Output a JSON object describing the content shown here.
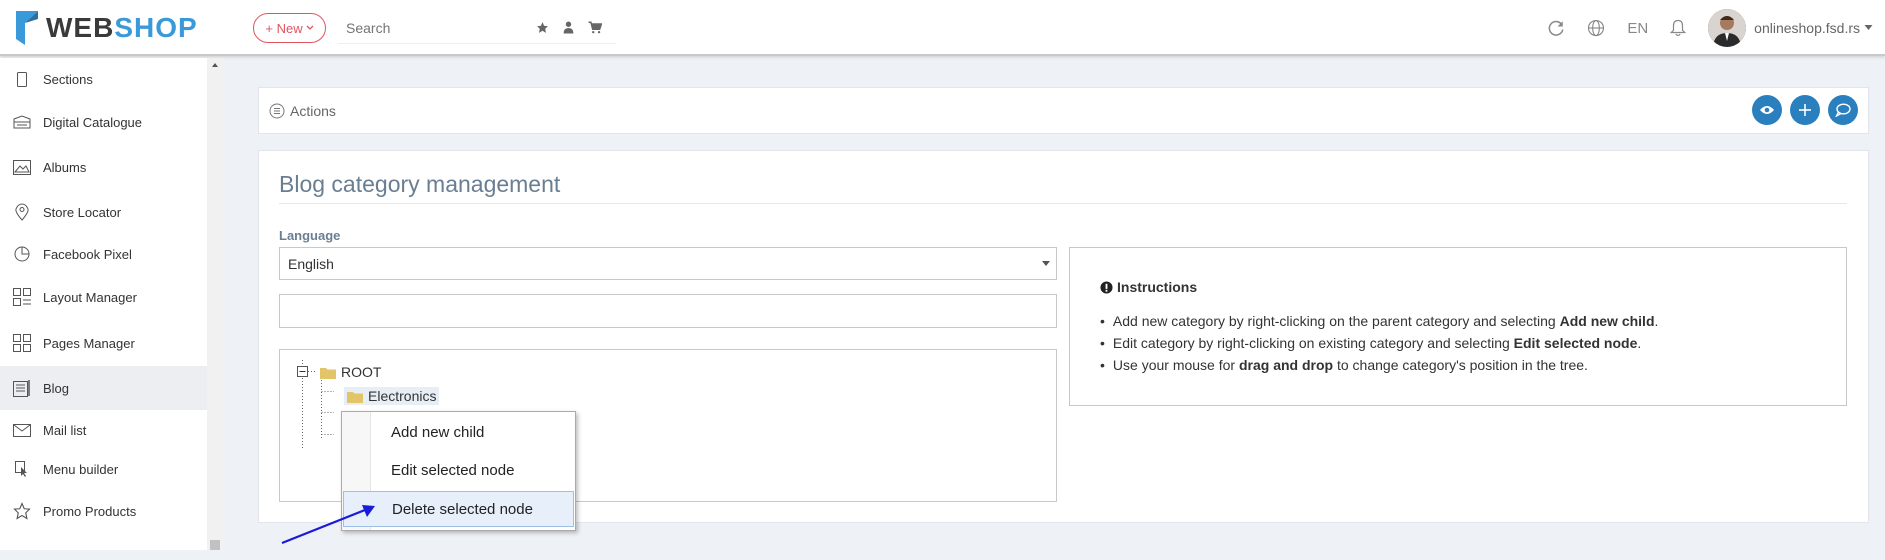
{
  "header": {
    "logo_web": "WEB",
    "logo_shop": "SHOP",
    "new_label": "+ New",
    "search_placeholder": "Search",
    "lang": "EN",
    "user": "onlineshop.fsd.rs"
  },
  "sidebar": {
    "items": [
      {
        "label": "Sections",
        "icon": "tablet-icon"
      },
      {
        "label": "Digital Catalogue",
        "icon": "catalogue-icon"
      },
      {
        "label": "Albums",
        "icon": "image-icon"
      },
      {
        "label": "Store Locator",
        "icon": "map-pin-icon"
      },
      {
        "label": "Facebook Pixel",
        "icon": "pie-chart-icon"
      },
      {
        "label": "Layout Manager",
        "icon": "layout-icon"
      },
      {
        "label": "Pages Manager",
        "icon": "pages-icon"
      },
      {
        "label": "Blog",
        "icon": "blog-icon",
        "active": true
      },
      {
        "label": "Mail list",
        "icon": "mail-icon"
      },
      {
        "label": "Menu builder",
        "icon": "cursor-icon"
      },
      {
        "label": "Promo Products",
        "icon": "star-icon"
      }
    ]
  },
  "actions": {
    "label": "Actions"
  },
  "page": {
    "title": "Blog category management",
    "language_label": "Language",
    "language_value": "English"
  },
  "tree": {
    "root": "ROOT",
    "child": "Electronics"
  },
  "instructions": {
    "title": "Instructions",
    "items": [
      {
        "pre": "Add new category by right-clicking on the parent category and selecting ",
        "bold": "Add new child",
        "post": "."
      },
      {
        "pre": "Edit category by right-clicking on existing category and selecting ",
        "bold": "Edit selected node",
        "post": "."
      },
      {
        "pre": "Use your mouse for ",
        "bold": "drag and drop",
        "post": " to change category's position in the tree."
      }
    ]
  },
  "context_menu": {
    "items": [
      "Add new child",
      "Edit selected node",
      "Delete selected node"
    ],
    "highlighted_index": 2
  },
  "colors": {
    "accent": "#2a7fbf",
    "brand_blue": "#3a9ad9",
    "new_red": "#e05560",
    "title": "#6a7e92"
  }
}
